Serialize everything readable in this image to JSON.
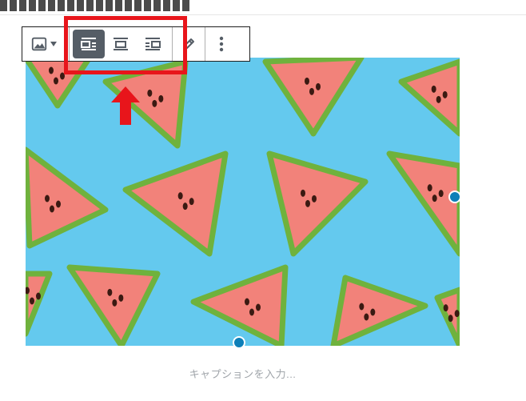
{
  "editor": {
    "caption_placeholder": "キャプションを入力..."
  },
  "toolbar": {
    "buttons": [
      {
        "name": "change-block-type",
        "icon": "image-icon",
        "active": false
      },
      {
        "name": "align-left",
        "icon": "align-left-icon",
        "active": true
      },
      {
        "name": "align-center",
        "icon": "align-center-icon",
        "active": false
      },
      {
        "name": "align-right",
        "icon": "align-right-icon",
        "active": false
      },
      {
        "name": "edit",
        "icon": "pencil-icon",
        "active": false
      },
      {
        "name": "more-options",
        "icon": "more-vertical-icon",
        "active": false
      }
    ]
  },
  "colors": {
    "highlight": "#e8151b",
    "active_button": "#555d66",
    "image_background": "#64c9ee",
    "watermelon_flesh": "#f2827a",
    "watermelon_rind": "#6fb23d",
    "resize_handle": "#0d7fb8"
  }
}
